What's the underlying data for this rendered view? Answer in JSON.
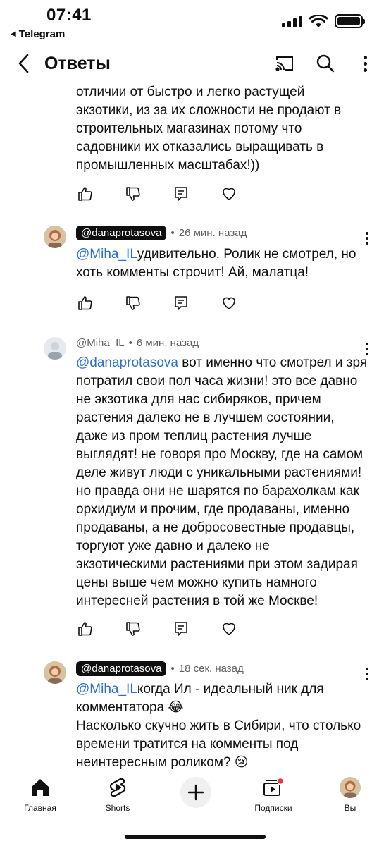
{
  "status": {
    "time": "07:41",
    "back_app": "Telegram"
  },
  "header": {
    "title": "Ответы"
  },
  "comments": [
    {
      "text_lines": [
        "отличии от быстро и легко растущей",
        "экзотики, из за их сложности не продают в",
        "строительных магазинах потому что",
        "садовники их отказались выращивать в",
        "промышленных масштабах!))"
      ]
    },
    {
      "author": "@danaprotasova",
      "time": "26 мин. назад",
      "mention": "@Miha_IL",
      "first_line_rest": "удивительно. Ролик не смотрел, но",
      "text_lines": [
        "хоть комменты строчит! Ай, малатца!"
      ]
    },
    {
      "author": "@Miha_IL",
      "time": "6 мин. назад",
      "mention": "@danaprotasova",
      "first_line_rest": " вот именно что смотрел и зря",
      "text_lines": [
        "потратил свои пол часа жизни! это все давно",
        "не экзотика для нас сибиряков, причем",
        "растения далеко не в лучшем состоянии,",
        "даже из пром теплиц растения лучше",
        "выглядят! не говоря про Москву, где на самом",
        "деле живут люди с уникальными растениями!",
        "но правда они не шарятся по барахолкам как",
        "орхидиум и прочим, где продаваны, именно",
        "продаваны, а не добросовестные продавцы,",
        "торгуют уже давно и далеко не",
        "экзотическими растениями при этом задирая",
        "цены выше чем можно купить намного",
        "интересней растения в той же Москве!"
      ]
    },
    {
      "author": "@danaprotasova",
      "time": "18 сек. назад",
      "mention": "@Miha_IL",
      "first_line_rest": "когда Ил - идеальный ник для",
      "text_lines": [
        "комментатора 😂",
        "Насколько скучно жить в Сибири, что столько",
        "времени тратится на комменты под",
        "неинтересным роликом? 😢"
      ]
    }
  ],
  "bottom_nav": {
    "home": "Главная",
    "shorts": "Shorts",
    "subscriptions": "Подписки",
    "you": "Вы"
  },
  "colors": {
    "mention": "#2a6fce",
    "chip_bg": "#0f0f0f",
    "notification_dot": "#e53935"
  },
  "icons": [
    "back-icon",
    "cast-icon",
    "search-icon",
    "more-vert-icon",
    "like-icon",
    "dislike-icon",
    "reply-icon",
    "heart-icon",
    "home-icon",
    "shorts-icon",
    "plus-icon",
    "subscriptions-icon"
  ]
}
